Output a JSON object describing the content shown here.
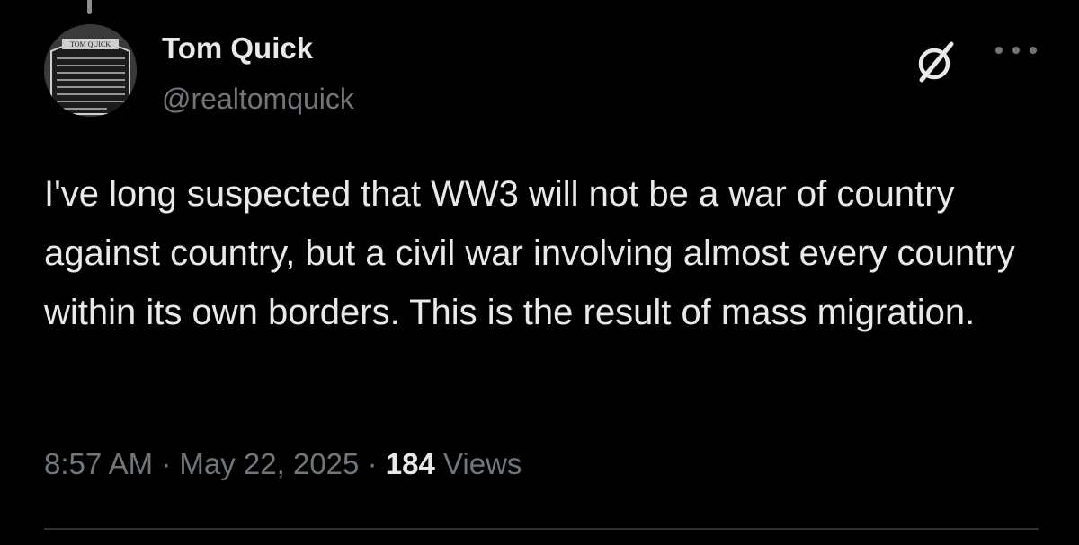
{
  "tweet": {
    "author": {
      "display_name": "Tom Quick",
      "handle": "@realtomquick",
      "avatar_sign_title": "TOM QUICK"
    },
    "text": "I've long suspected that WW3 will not be a war of country against country, but a civil war involving almost every country within its own borders. This is the result of mass migration.",
    "time": "8:57 AM",
    "separator": "·",
    "date": "May 22, 2025",
    "views_count": "184",
    "views_label": "Views"
  },
  "icons": {
    "grok": "grok-icon",
    "more": "more-icon"
  },
  "colors": {
    "background": "#000000",
    "primary_text": "#e7e9ea",
    "secondary_text": "#71767b",
    "divider": "#2f3336"
  }
}
